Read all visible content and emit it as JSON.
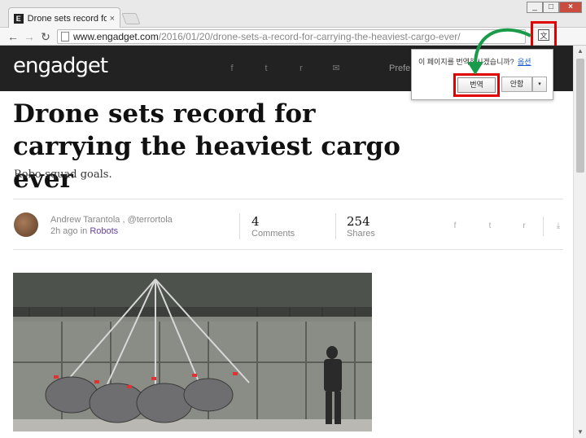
{
  "browser": {
    "tab_title": "Drone sets record for car",
    "tab_favicon": "E",
    "tab_close": "×",
    "url_host": "www.engadget.com",
    "url_path": "/2016/01/20/drone-sets-a-record-for-carrying-the-heaviest-cargo-ever/",
    "translate_icon": "translate-icon",
    "window_min": "_",
    "window_max": "□",
    "window_close": "×"
  },
  "site": {
    "logo": "engadget",
    "header_icons": [
      "facebook-icon",
      "twitter-icon",
      "reddit-icon",
      "email-icon"
    ],
    "header_icon_glyphs": [
      "f",
      "t",
      "r",
      "✉"
    ],
    "preferences_label": "Prefe"
  },
  "translate_popup": {
    "question": "이 페이지를 번역하시겠습니까?",
    "options_link": "옵션",
    "translate_button": "번역",
    "decline_button": "안함",
    "dropdown_glyph": "▾"
  },
  "article": {
    "title": "Drone sets record for carrying the heaviest cargo ever",
    "subtitle": "Robo-squad goals.",
    "author": "Andrew Tarantola , @terrortola",
    "time_ago": "2h ago in ",
    "category": "Robots",
    "comments_count": "4",
    "comments_label": "Comments",
    "shares_count": "254",
    "shares_label": "Shares",
    "share_icons": [
      "facebook-icon",
      "twitter-icon",
      "reddit-icon",
      "download-icon"
    ],
    "share_icon_glyphs": [
      "f",
      "t",
      "r",
      "⤓"
    ]
  },
  "colors": {
    "header_bg": "#222222",
    "highlight_red": "#e00000",
    "arrow_green": "#1a9b4a",
    "category_purple": "#6a3ea1"
  }
}
